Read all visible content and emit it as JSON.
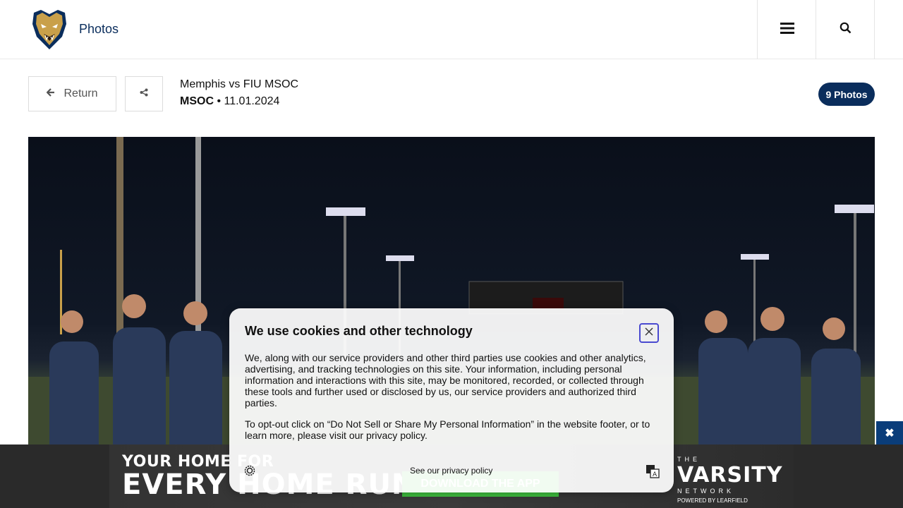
{
  "header": {
    "section_title": "Photos"
  },
  "gallery": {
    "return_label": "Return",
    "title": "Memphis vs FIU MSOC",
    "sport": "MSOC",
    "separator": " • ",
    "date": "11.01.2024",
    "photo_count": "9 Photos"
  },
  "cookie": {
    "title": "We use cookies and other technology",
    "paragraph1": "We, along with our service providers and other third parties use cookies and other analytics, advertising, and tracking technologies on this site. Your information, including personal information and interactions with this site, may be monitored, recorded, or collected through these tools and further used or disclosed by us, our service providers and authorized third parties.",
    "paragraph2": "To opt-out click on “Do Not Sell or Share My Personal Information” in the website footer, or to learn more, please visit our privacy policy.",
    "privacy_link": "See our privacy policy"
  },
  "ad": {
    "line1": "YOUR HOME FOR",
    "line2": "EVERY HOME RUN.",
    "cta": "DOWNLOAD THE APP",
    "brand": "VARSITY",
    "brand_prefix": "THE",
    "network": "NETWORK",
    "powered": "POWERED BY  LEARFIELD"
  },
  "colors": {
    "primary": "#0a2d5c",
    "ad_close": "#0a3d7a",
    "cta_green": "#3fbf3f"
  }
}
